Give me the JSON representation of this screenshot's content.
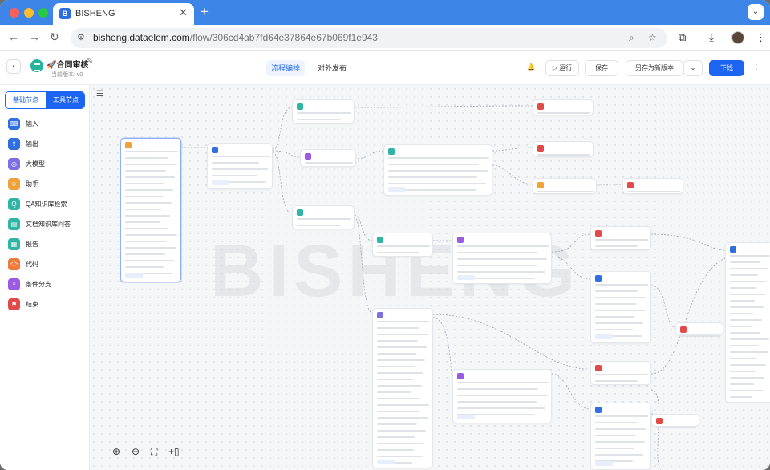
{
  "browser": {
    "tab_title": "BISHENG",
    "tab_favicon": "B",
    "url_host": "bisheng.dataelem.com",
    "url_path": "/flow/306cd4ab7fd64e37864e67b069f1e943",
    "icons": [
      "back-icon",
      "forward-icon",
      "reload-icon",
      "site-settings-icon",
      "zoom-icon",
      "bookmark-star-icon",
      "extensions-icon",
      "download-icon",
      "profile-avatar",
      "more-menu-icon"
    ]
  },
  "header": {
    "title": "🚀合同审核",
    "version": "当前版本: v0",
    "tabs": [
      "流程编排",
      "对外发布"
    ],
    "buttons": {
      "run": "运行",
      "save": "保存",
      "save_as": "另存为新版本",
      "publish": "下线"
    },
    "colors": {
      "accent": "#1c64f2",
      "logo": "#24b39b"
    }
  },
  "sidebar": {
    "tabs": [
      "基础节点",
      "工具节点"
    ],
    "active_tab": "工具节点",
    "items": [
      {
        "label": "输入",
        "icon": "input-icon",
        "color": "#2f6fe0"
      },
      {
        "label": "输出",
        "icon": "output-icon",
        "color": "#2f6fe0"
      },
      {
        "label": "大模型",
        "icon": "llm-icon",
        "color": "#7b6fe3"
      },
      {
        "label": "助手",
        "icon": "assistant-icon",
        "color": "#f0a23a"
      },
      {
        "label": "QA知识库检索",
        "icon": "qa-retrieval-icon",
        "color": "#2fb5a5"
      },
      {
        "label": "文档知识库问答",
        "icon": "doc-qa-icon",
        "color": "#2fb5a5"
      },
      {
        "label": "报告",
        "icon": "report-icon",
        "color": "#2fb5a5"
      },
      {
        "label": "代码",
        "icon": "code-icon",
        "color": "#f07a3a"
      },
      {
        "label": "条件分支",
        "icon": "condition-branch-icon",
        "color": "#9b5be0"
      },
      {
        "label": "结束",
        "icon": "end-flag-icon",
        "color": "#e24a4a"
      }
    ]
  },
  "canvas": {
    "watermark": "BISHENG"
  }
}
